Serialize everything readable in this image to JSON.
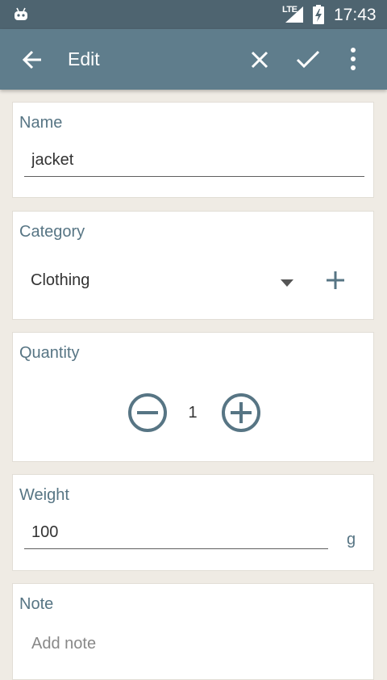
{
  "status_bar": {
    "network": "LTE",
    "time": "17:43"
  },
  "app_bar": {
    "title": "Edit",
    "icons": [
      "back-arrow-icon",
      "close-icon",
      "check-icon",
      "more-vert-icon"
    ]
  },
  "name_card": {
    "label": "Name",
    "value": "jacket"
  },
  "category_card": {
    "label": "Category",
    "selected": "Clothing"
  },
  "quantity_card": {
    "label": "Quantity",
    "value": "1"
  },
  "weight_card": {
    "label": "Weight",
    "value": "100",
    "unit": "g"
  },
  "note_card": {
    "label": "Note",
    "placeholder": "Add note"
  },
  "colors": {
    "status_bar": "#4e6470",
    "app_bar": "#5f7d8c",
    "accent": "#577584",
    "background": "#efebe4"
  }
}
